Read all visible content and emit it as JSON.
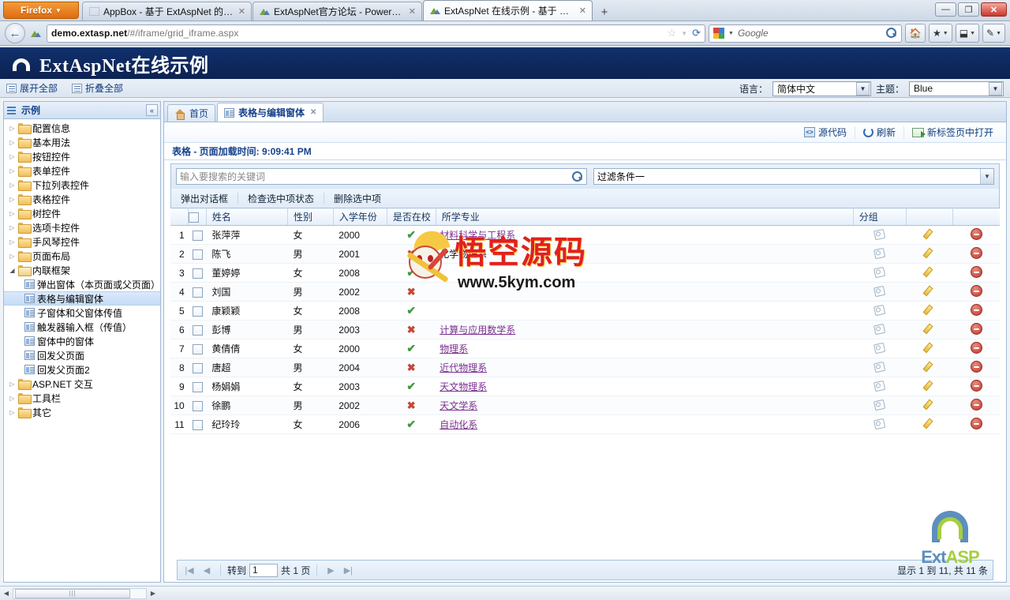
{
  "browser": {
    "app_button": "Firefox",
    "tabs": [
      {
        "title": "AppBox - 基于 ExtAspNet 的企业通...",
        "active": false,
        "favicon": "blank-icon"
      },
      {
        "title": "ExtAspNet官方论坛 - Powered by ...",
        "active": false,
        "favicon": "site-favicon"
      },
      {
        "title": "ExtAspNet 在线示例 - 基于 ExtJS 的...",
        "active": true,
        "favicon": "site-favicon"
      }
    ],
    "new_tab_label": "+",
    "window_buttons": {
      "minimize": "—",
      "restore": "❐",
      "close": "✕"
    },
    "url": "demo.extasp.net/#/iframe/grid_iframe.aspx",
    "url_host": "demo.extasp.net",
    "search_placeholder": "Google",
    "search_engine_icon": "google-icon"
  },
  "site": {
    "title": "ExtAspNet在线示例",
    "toolbar": {
      "expand_all": "展开全部",
      "collapse_all": "折叠全部",
      "language_label": "语言：",
      "language_value": "简体中文",
      "theme_label": "主题：",
      "theme_value": "Blue"
    }
  },
  "sidebar": {
    "header": "示例",
    "collapse_label": "«",
    "items": [
      {
        "label": "配置信息",
        "type": "folder",
        "level": 0,
        "expanded": false
      },
      {
        "label": "基本用法",
        "type": "folder",
        "level": 0,
        "expanded": false
      },
      {
        "label": "按钮控件",
        "type": "folder",
        "level": 0,
        "expanded": false
      },
      {
        "label": "表单控件",
        "type": "folder",
        "level": 0,
        "expanded": false
      },
      {
        "label": "下拉列表控件",
        "type": "folder",
        "level": 0,
        "expanded": false
      },
      {
        "label": "表格控件",
        "type": "folder",
        "level": 0,
        "expanded": false
      },
      {
        "label": "树控件",
        "type": "folder",
        "level": 0,
        "expanded": false
      },
      {
        "label": "选项卡控件",
        "type": "folder",
        "level": 0,
        "expanded": false
      },
      {
        "label": "手风琴控件",
        "type": "folder",
        "level": 0,
        "expanded": false
      },
      {
        "label": "页面布局",
        "type": "folder",
        "level": 0,
        "expanded": false
      },
      {
        "label": "内联框架",
        "type": "folder",
        "level": 0,
        "expanded": true
      },
      {
        "label": "弹出窗体（本页面或父页面）",
        "type": "page",
        "level": 1,
        "selected": false
      },
      {
        "label": "表格与编辑窗体",
        "type": "page",
        "level": 1,
        "selected": true
      },
      {
        "label": "子窗体和父窗体传值",
        "type": "page",
        "level": 1,
        "selected": false
      },
      {
        "label": "触发器输入框（传值）",
        "type": "page",
        "level": 1,
        "selected": false
      },
      {
        "label": "窗体中的窗体",
        "type": "page",
        "level": 1,
        "selected": false
      },
      {
        "label": "回发父页面",
        "type": "page",
        "level": 1,
        "selected": false
      },
      {
        "label": "回发父页面2",
        "type": "page",
        "level": 1,
        "selected": false
      },
      {
        "label": "ASP.NET 交互",
        "type": "folder",
        "level": 0,
        "expanded": false
      },
      {
        "label": "工具栏",
        "type": "folder",
        "level": 0,
        "expanded": false
      },
      {
        "label": "其它",
        "type": "folder",
        "level": 0,
        "expanded": false
      }
    ]
  },
  "page_tabs": [
    {
      "label": "首页",
      "active": false,
      "icon": "home-icon",
      "closable": false
    },
    {
      "label": "表格与编辑窗体",
      "active": true,
      "icon": "page-icon",
      "closable": true
    }
  ],
  "actions": [
    {
      "label": "源代码",
      "icon": "source-code-icon"
    },
    {
      "label": "刷新",
      "icon": "refresh-icon"
    },
    {
      "label": "新标签页中打开",
      "icon": "open-new-tab-icon"
    }
  ],
  "grid": {
    "title": "表格 - 页面加载时间: 9:09:41 PM",
    "search_placeholder": "输入要搜索的关键词",
    "search_value": "",
    "search_icon": "magnify-icon",
    "filter_value": "过滤条件一",
    "toolbar_buttons": [
      "弹出对话框",
      "检查选中项状态",
      "删除选中项"
    ],
    "columns": [
      "",
      "",
      "姓名",
      "性别",
      "入学年份",
      "是否在校",
      "所学专业",
      "分组",
      "",
      ""
    ],
    "rows": [
      {
        "n": "1",
        "name": "张萍萍",
        "gender": "女",
        "year": "2000",
        "enrolled": true,
        "major": "材料科学与工程系",
        "major_link": true,
        "tag": "#9fd4e8"
      },
      {
        "n": "2",
        "name": "陈飞",
        "gender": "男",
        "year": "2001",
        "enrolled": false,
        "major": "化学物理系",
        "major_link": false,
        "tag": "#9fd4e8"
      },
      {
        "n": "3",
        "name": "董婷婷",
        "gender": "女",
        "year": "2008",
        "enrolled": true,
        "major": "",
        "major_link": true,
        "tag": "#9ed99e"
      },
      {
        "n": "4",
        "name": "刘国",
        "gender": "男",
        "year": "2002",
        "enrolled": false,
        "major": "",
        "major_link": true,
        "tag": "#9ed99e"
      },
      {
        "n": "5",
        "name": "康颖颖",
        "gender": "女",
        "year": "2008",
        "enrolled": true,
        "major": "",
        "major_link": true,
        "tag": "#f0bb77"
      },
      {
        "n": "6",
        "name": "彭博",
        "gender": "男",
        "year": "2003",
        "enrolled": false,
        "major": "计算与应用数学系",
        "major_link": true,
        "tag": "#f0bb77"
      },
      {
        "n": "7",
        "name": "黄倩倩",
        "gender": "女",
        "year": "2000",
        "enrolled": true,
        "major": "物理系",
        "major_link": true,
        "tag": "#e3a8e0"
      },
      {
        "n": "8",
        "name": "唐超",
        "gender": "男",
        "year": "2004",
        "enrolled": false,
        "major": "近代物理系",
        "major_link": true,
        "tag": "#e3a8e0"
      },
      {
        "n": "9",
        "name": "杨娟娟",
        "gender": "女",
        "year": "2003",
        "enrolled": true,
        "major": "天文物理系",
        "major_link": true,
        "tag": "#a9a6e0"
      },
      {
        "n": "10",
        "name": "徐鹏",
        "gender": "男",
        "year": "2002",
        "enrolled": false,
        "major": "天文学系",
        "major_link": true,
        "tag": "#a9a6e0"
      },
      {
        "n": "11",
        "name": "纪玲玲",
        "gender": "女",
        "year": "2006",
        "enrolled": true,
        "major": "自动化系",
        "major_link": true,
        "tag": "#a9a6e0"
      }
    ],
    "enrolled_yes_glyph": "✔",
    "enrolled_no_glyph": "✖",
    "row_edit_icon": "pencil-icon",
    "row_delete_icon": "delete-icon",
    "row_tag_icon": "tag-icon"
  },
  "pager": {
    "first": "|◀",
    "prev": "◀",
    "goto_label": "转到",
    "page_value": "1",
    "total_label": "共 1 页",
    "next": "▶",
    "last": "▶|",
    "summary": "显示 1 到 11, 共 11 条"
  },
  "watermark": {
    "text": "悟空源码",
    "url": "www.5kym.com"
  },
  "logo": {
    "ext": "Ext",
    "asp": "ASP"
  },
  "colors": {
    "header_bg": "#0c2252",
    "accent": "#15428b",
    "link": "#7a2f8f",
    "tick": "#3f9a3f",
    "cross": "#cc4433",
    "firefox": "#e06c10"
  }
}
